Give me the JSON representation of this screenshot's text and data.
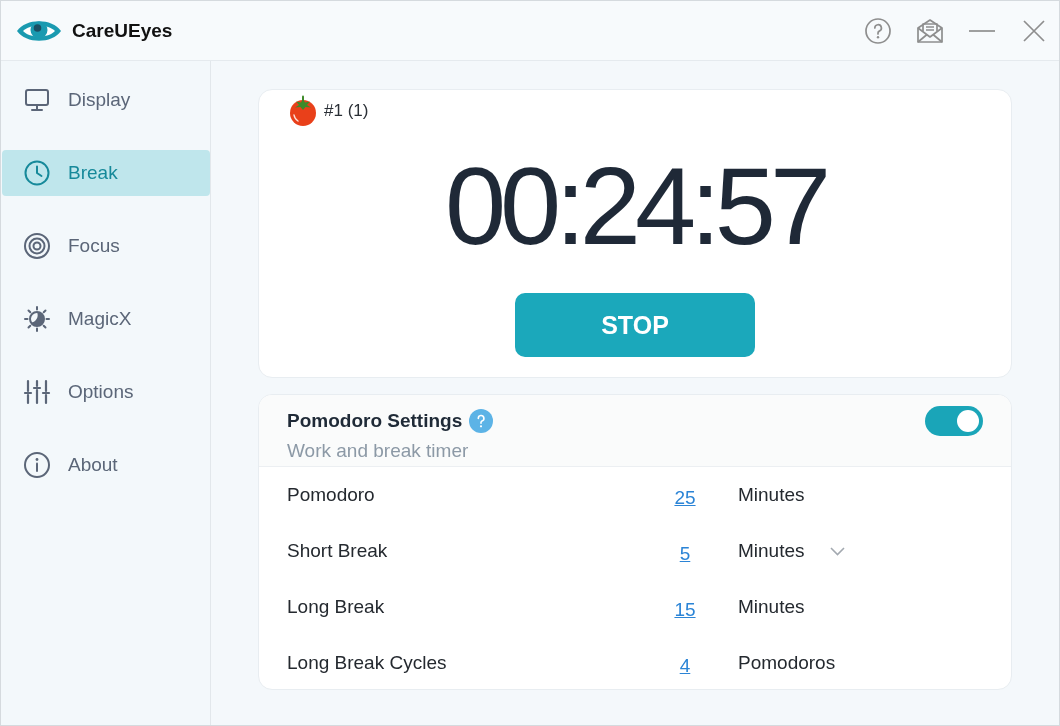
{
  "app": {
    "title": "CareUEyes"
  },
  "sidebar": {
    "items": [
      {
        "label": "Display",
        "selected": false
      },
      {
        "label": "Break",
        "selected": true
      },
      {
        "label": "Focus",
        "selected": false
      },
      {
        "label": "MagicX",
        "selected": false
      },
      {
        "label": "Options",
        "selected": false
      },
      {
        "label": "About",
        "selected": false
      }
    ]
  },
  "timer": {
    "session": "#1 (1)",
    "time": "00:24:57",
    "button": "STOP"
  },
  "pomodoro_settings": {
    "title": "Pomodoro Settings",
    "subtitle": "Work and break timer",
    "enabled": true,
    "rows": [
      {
        "label": "Pomodoro",
        "value": "25",
        "unit": "Minutes",
        "dropdown": false
      },
      {
        "label": "Short Break",
        "value": "5",
        "unit": "Minutes",
        "dropdown": true
      },
      {
        "label": "Long Break",
        "value": "15",
        "unit": "Minutes",
        "dropdown": false
      },
      {
        "label": "Long Break Cycles",
        "value": "4",
        "unit": "Pomodoros",
        "dropdown": false
      }
    ]
  }
}
